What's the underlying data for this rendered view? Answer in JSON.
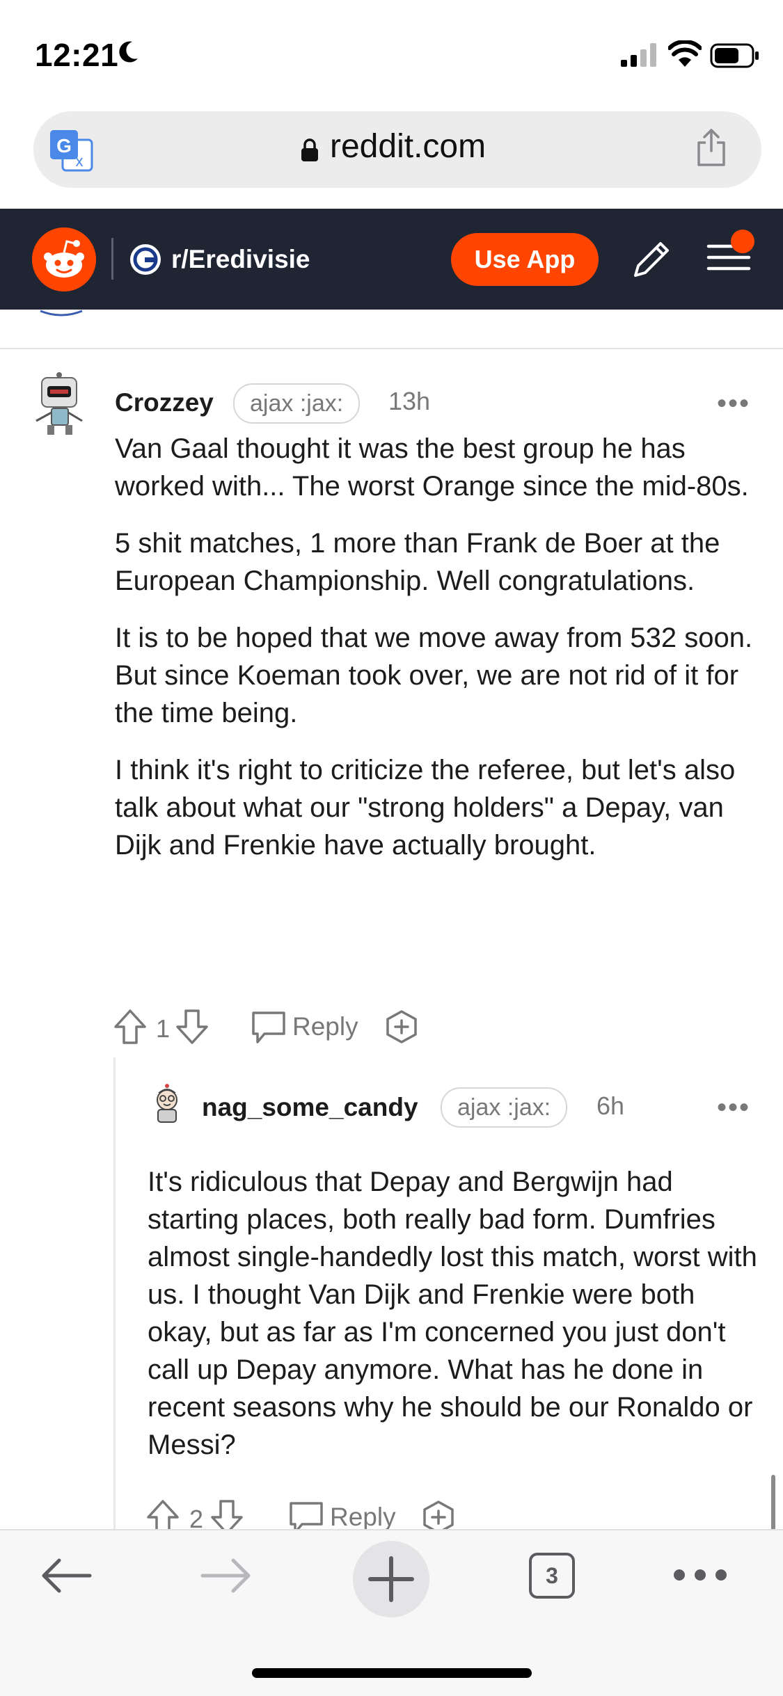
{
  "status_bar": {
    "time": "12:21"
  },
  "browser": {
    "url": "reddit.com",
    "icons": [
      "translate-icon",
      "lock-icon",
      "share-icon"
    ]
  },
  "header": {
    "subreddit": "r/Eredivisie",
    "use_app_label": "Use App",
    "accent": "#ff4500",
    "background": "#1f2533"
  },
  "comments": [
    {
      "author": "Crozzey",
      "flair": "ajax :jax:",
      "age": "13h",
      "more": "•••",
      "paragraphs": [
        "Van Gaal thought it was the best group he has worked with... The worst Orange since the mid-80s.",
        "5 shit matches, 1 more than Frank de Boer at the European Championship. Well congratulations.",
        "It is to be hoped that we move away from 532 soon. But since Koeman took over, we are not rid of it for the time being.",
        "I think it's right to criticize the referee, but let's also talk about what our \"strong holders\" a Depay, van Dijk and Frenkie have actually brought."
      ],
      "score": "1",
      "reply_label": "Reply"
    },
    {
      "author": "nag_some_candy",
      "flair": "ajax :jax:",
      "age": "6h",
      "more": "•••",
      "paragraphs": [
        "It's ridiculous that Depay and Bergwijn had starting places, both really bad form. Dumfries almost single-handedly lost this match, worst with us. I thought Van Dijk and Frenkie were both okay, but as far as I'm concerned you just don't call up Depay anymore. What has he done in recent seasons why he should be our Ronaldo or Messi?"
      ],
      "score": "2",
      "reply_label": "Reply"
    }
  ],
  "toolbar": {
    "tab_count": "3"
  }
}
